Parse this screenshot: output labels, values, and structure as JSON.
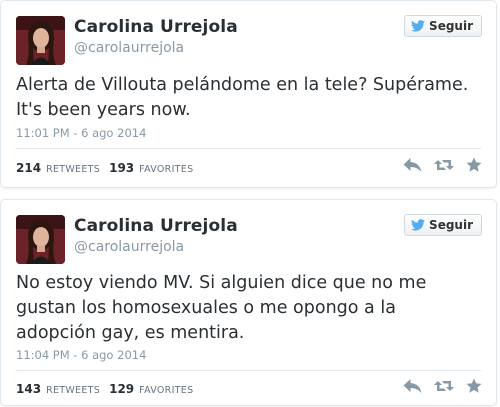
{
  "tweets": [
    {
      "author": {
        "name": "Carolina Urrejola",
        "handle": "@carolaurrejola"
      },
      "follow_label": "Seguir",
      "text": "Alerta de Villouta pelándome en la tele? Supérame. It's been years now.",
      "timestamp": "11:01 PM - 6 ago 2014",
      "stats": {
        "retweets": "214",
        "retweets_label": "RETWEETS",
        "favorites": "193",
        "favorites_label": "FAVORITES"
      },
      "icons": [
        "reply-icon",
        "retweet-icon",
        "favorite-icon"
      ]
    },
    {
      "author": {
        "name": "Carolina Urrejola",
        "handle": "@carolaurrejola"
      },
      "follow_label": "Seguir",
      "text": "No estoy viendo MV. Si alguien dice que no me gustan los homosexuales o me opongo a la adopción gay, es mentira.",
      "timestamp": "11:04 PM - 6 ago 2014",
      "stats": {
        "retweets": "143",
        "retweets_label": "RETWEETS",
        "favorites": "129",
        "favorites_label": "FAVORITES"
      },
      "icons": [
        "reply-icon",
        "retweet-icon",
        "favorite-icon"
      ]
    }
  ],
  "colors": {
    "brand_blue": "#55acee",
    "text": "#292f33",
    "muted": "#8899a6",
    "icon_gray": "#8899a6",
    "border": "#e1e8ed"
  }
}
